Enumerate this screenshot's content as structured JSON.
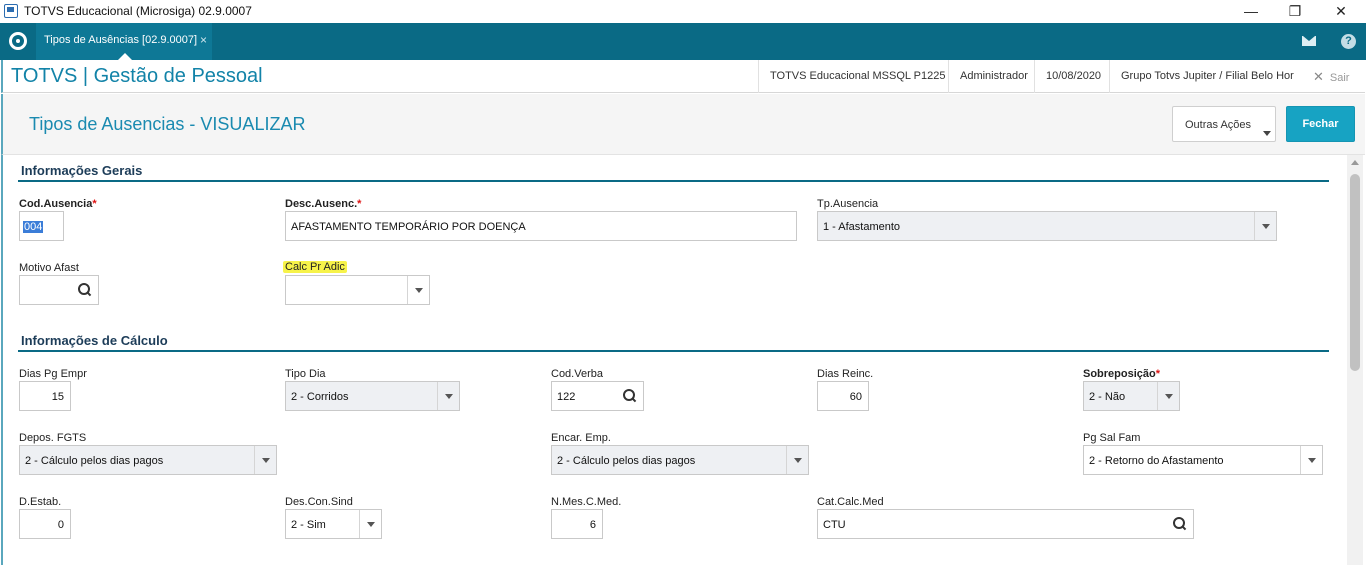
{
  "window": {
    "title": "TOTVS Educacional (Microsiga) 02.9.0007",
    "minimize": "—",
    "restore": "❐",
    "close": "✕"
  },
  "tabbar": {
    "tab_label": "Tipos de Ausências [02.9.0007]",
    "tab_close": "×",
    "help": "?"
  },
  "header": {
    "brand": "TOTVS | Gestão de Pessoal",
    "environment": "TOTVS Educacional MSSQL P1225",
    "user": "Administrador",
    "date": "10/08/2020",
    "company": "Grupo Totvs Jupiter / Filial Belo Hor",
    "exit_label": "Sair"
  },
  "page": {
    "title": "Tipos de Ausencias - VISUALIZAR",
    "other_actions": "Outras Ações",
    "close_button": "Fechar"
  },
  "general": {
    "section_title": "Informações Gerais",
    "cod_ausencia": {
      "label": "Cod.Ausencia",
      "value": "004"
    },
    "desc_ausenc": {
      "label": "Desc.Ausenc.",
      "value": "AFASTAMENTO TEMPORÁRIO POR DOENÇA"
    },
    "tp_ausencia": {
      "label": "Tp.Ausencia",
      "value": "1 - Afastamento"
    },
    "motivo_afast": {
      "label": "Motivo Afast",
      "value": ""
    },
    "calc_pr_adic": {
      "label": "Calc Pr Adic",
      "value": ""
    }
  },
  "calc": {
    "section_title": "Informações de Cálculo",
    "dias_pg_empr": {
      "label": "Dias Pg Empr",
      "value": "15"
    },
    "tipo_dia": {
      "label": "Tipo Dia",
      "value": "2 - Corridos"
    },
    "cod_verba": {
      "label": "Cod.Verba",
      "value": "122"
    },
    "dias_reinc": {
      "label": "Dias Reinc.",
      "value": "60"
    },
    "sobreposicao": {
      "label": "Sobreposição",
      "value": "2 - Não"
    },
    "depos_fgts": {
      "label": "Depos. FGTS",
      "value": "2 - Cálculo pelos dias pagos"
    },
    "encar_emp": {
      "label": "Encar. Emp.",
      "value": "2 - Cálculo pelos dias pagos"
    },
    "pg_sal_fam": {
      "label": "Pg Sal Fam",
      "value": "2 - Retorno do Afastamento"
    },
    "d_estab": {
      "label": "D.Estab.",
      "value": "0"
    },
    "des_con_sind": {
      "label": "Des.Con.Sind",
      "value": "2 - Sim"
    },
    "n_mes_c_med": {
      "label": "N.Mes.C.Med.",
      "value": "6"
    },
    "cat_calc_med": {
      "label": "Cat.Calc.Med",
      "value": "CTU"
    }
  },
  "required_marker": "*"
}
